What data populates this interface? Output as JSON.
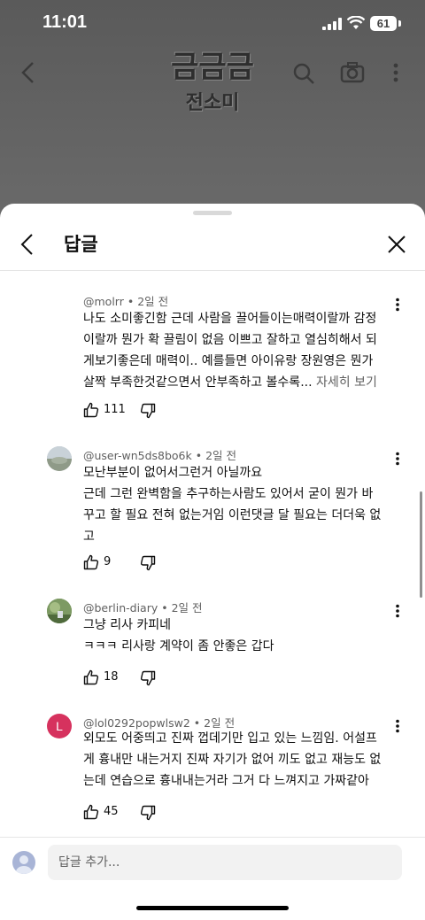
{
  "status_bar": {
    "time": "11:01",
    "battery": "61"
  },
  "video": {
    "title": "금금금",
    "subtitle": "전소미"
  },
  "header": {
    "title": "답글"
  },
  "comments": [
    {
      "author": "@molrr",
      "time": "2일 전",
      "lines": [
        "나도 소미좋긴함 근데 사람을 끌어들이는매력이랄까 감정",
        "이랄까 뭔가 확 끌림이 없음 이쁘고 잘하고 열심히해서 되",
        "게보기좋은데 매력이.. 예를들면 아이유랑 장원영은 뭔가",
        "살짝 부족한것같으면서 안부족하고 볼수록..."
      ],
      "more": "자세히 보기",
      "likes": "111",
      "avatar": "none"
    },
    {
      "author": "@user-wn5ds8bo6k",
      "time": "2일 전",
      "lines": [
        "모난부분이 없어서그런거 아닐까요",
        "근데 그런 완벽함을 추구하는사람도 있어서 굳이 뭔가 바",
        "꾸고 할 필요 전혀 없는거임 이런댓글 달 필요는 더더욱 없",
        "고"
      ],
      "likes": "9",
      "avatar": "photo-landscape"
    },
    {
      "author": "@berlin-diary",
      "time": "2일 전",
      "lines": [
        "그냥 리사 카피네",
        "ㅋㅋㅋ 리사랑 계약이 좀 안좋은 갑다"
      ],
      "likes": "18",
      "avatar": "photo-nature"
    },
    {
      "author": "@lol0292popwlsw2",
      "time": "2일 전",
      "lines": [
        "외모도 어중띄고 진짜 껍데기만 입고 있는 느낌임. 어설프",
        "게 흉내만 내는거지 진짜 자기가 없어 끼도 없고 재능도 없",
        "는데 연습으로 흉내내는거라 그거 다 느껴지고 가짜같아"
      ],
      "likes": "45",
      "avatar_letter": "L",
      "avatar_color": "#d6325e"
    }
  ],
  "reply_box": {
    "placeholder": "답글 추가..."
  },
  "icons": {
    "back": "chevron-left-icon",
    "close": "close-icon",
    "more": "more-vert-icon",
    "like": "thumb-up-icon",
    "dislike": "thumb-down-icon",
    "search": "search-icon",
    "camera": "camera-icon"
  },
  "colors": {
    "text": "#0f0f0f",
    "secondary": "#606060",
    "input_bg": "#f2f2f2"
  }
}
